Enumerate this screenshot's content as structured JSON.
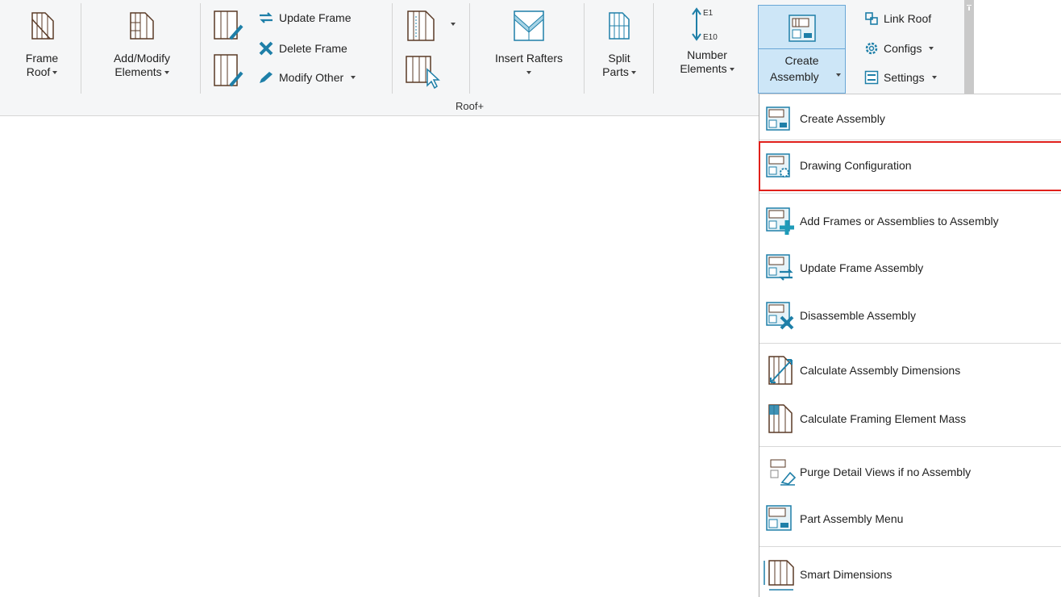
{
  "ribbon": {
    "panel_label": "Roof+",
    "frame_roof": {
      "line1": "Frame",
      "line2": "Roof"
    },
    "add_modify": {
      "line1": "Add/Modify",
      "line2": "Elements"
    },
    "update_frame": "Update Frame",
    "delete_frame": "Delete Frame",
    "modify_other": "Modify Other",
    "insert_rafters": "Insert Rafters",
    "split_parts": {
      "line1": "Split",
      "line2": "Parts"
    },
    "number_elements": {
      "line1": "Number",
      "line2": "Elements",
      "tag_top": "E1",
      "tag_bottom": "E10"
    },
    "create_assembly": {
      "line1": "Create",
      "line2": "Assembly"
    },
    "link_roof": "Link Roof",
    "configs": "Configs",
    "settings": "Settings"
  },
  "menu": {
    "items": [
      {
        "label": "Create Assembly",
        "icon": "create-assembly-icon"
      },
      {
        "label": "Drawing Configuration",
        "icon": "drawing-configuration-icon",
        "highlighted": true
      },
      {
        "label": "Add Frames or Assemblies to Assembly",
        "icon": "add-to-assembly-icon"
      },
      {
        "label": "Update Frame Assembly",
        "icon": "update-assembly-icon"
      },
      {
        "label": "Disassemble Assembly",
        "icon": "disassemble-icon"
      },
      {
        "label": "Calculate Assembly Dimensions",
        "icon": "dimensions-icon"
      },
      {
        "label": "Calculate Framing Element Mass",
        "icon": "mass-icon"
      },
      {
        "label": "Purge Detail Views if no Assembly",
        "icon": "purge-icon"
      },
      {
        "label": "Part Assembly Menu",
        "icon": "part-assembly-icon"
      },
      {
        "label": "Smart Dimensions",
        "icon": "smart-dimensions-icon"
      }
    ]
  },
  "colors": {
    "accent": "#1e7fa8",
    "highlight": "#e0201b",
    "active_bg": "#cde6f7",
    "wood": "#7a4a2e"
  }
}
